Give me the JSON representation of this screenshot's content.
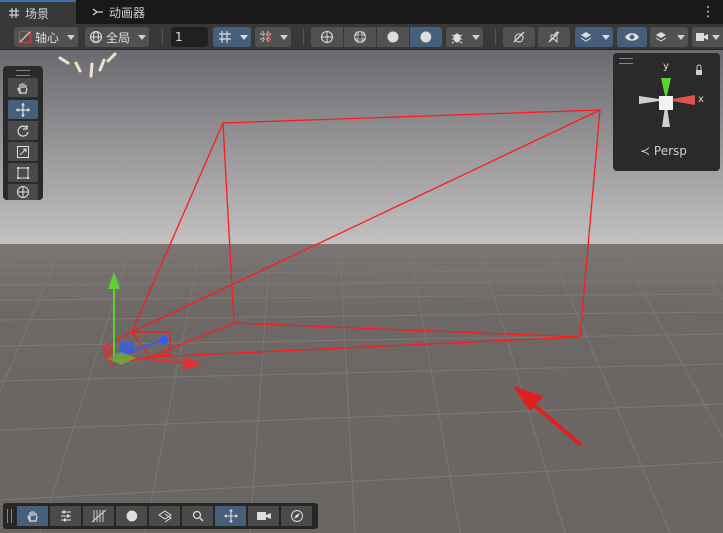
{
  "tabs": [
    {
      "label": "场景",
      "icon": "grid-icon",
      "active": true
    },
    {
      "label": "动画器",
      "icon": "animator-icon",
      "active": false
    }
  ],
  "toolbar": {
    "pivot_label": "轴心",
    "space_label": "全局",
    "snap_value": "1"
  },
  "gizmo": {
    "y_label": "y",
    "x_label": "x",
    "projection_label": "Persp"
  },
  "colors": {
    "accent": "#46607c",
    "camera_frustum": "#ff1a1a",
    "ground": "#6b6663",
    "sky": "#c0bebe",
    "annotation_arrow": "#e02020"
  }
}
